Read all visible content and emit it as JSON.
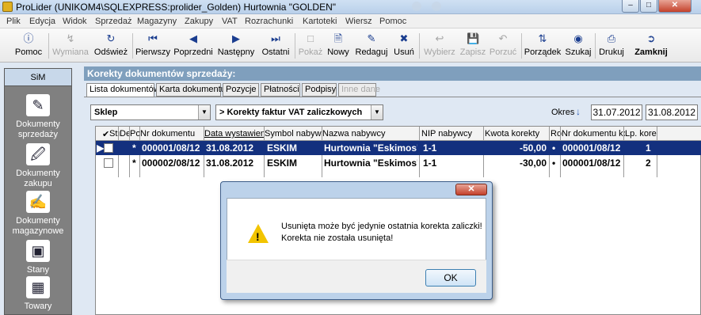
{
  "window": {
    "title": "ProLider  (UNIKOM4\\SQLEXPRESS:prolider_Golden) Hurtownia \"GOLDEN\"",
    "minimize": "–",
    "maximize": "□",
    "close": "✕"
  },
  "menu": [
    "Plik",
    "Edycja",
    "Widok",
    "Sprzedaż",
    "Magazyny",
    "Zakupy",
    "VAT",
    "Rozrachunki",
    "Kartoteki",
    "Wiersz",
    "Pomoc"
  ],
  "toolbar": {
    "pomoc": "Pomoc",
    "wymiana": "Wymiana",
    "odswiez": "Odśwież",
    "pierwszy": "Pierwszy",
    "poprzedni": "Poprzedni",
    "nastepny": "Następny",
    "ostatni": "Ostatni",
    "pokaz": "Pokaż",
    "nowy": "Nowy",
    "redaguj": "Redaguj",
    "usun": "Usuń",
    "wybierz": "Wybierz",
    "zapisz": "Zapisz",
    "porzuc": "Porzuć",
    "porzadek": "Porządek",
    "szukaj": "Szukaj",
    "drukuj": "Drukuj",
    "zamknij": "Zamknij"
  },
  "sidebar": {
    "header": "SiM",
    "items": [
      {
        "line1": "Dokumenty",
        "line2": "sprzedaży",
        "icon": "pen-document-icon"
      },
      {
        "line1": "Dokumenty",
        "line2": "zakupu",
        "icon": "purchase-document-icon"
      },
      {
        "line1": "Dokumenty",
        "line2": "magazynowe",
        "icon": "warehouse-document-icon"
      },
      {
        "line1": "Stany",
        "line2": "",
        "icon": "stock-icon"
      },
      {
        "line1": "Towary",
        "line2": "",
        "icon": "goods-icon"
      }
    ]
  },
  "main": {
    "header": "Korekty dokumentów sprzedaży:",
    "tabs": [
      "Lista dokumentów",
      "Karta dokumentu",
      "Pozycje",
      "Płatności",
      "Podpisy",
      "Inne dane"
    ],
    "store_combo": "Sklep",
    "type_combo": "> Korekty faktur VAT zaliczkowych",
    "okres_label": "Okres",
    "date_from": "31.07.2012",
    "date_to": "31.08.2012"
  },
  "grid": {
    "columns": [
      "✔",
      "Stı",
      "De",
      "Po",
      "Nr dokumentu",
      "Data wystawienia",
      "Symbol nabywcy",
      "Nazwa nabywcy",
      "NIP nabywcy",
      "Kwota korekty",
      "Ro",
      "Nr dokumentu kor",
      "Lp. kore"
    ],
    "rows": [
      {
        "star": "*",
        "nr": "000001/08/12",
        "data": "31.08.2012",
        "symbol": "ESKIM",
        "nazwa": "Hurtownia \"Eskimos\"",
        "nip": "1-1",
        "kwota": "-50,00",
        "ro": "•",
        "nrkor": "000001/08/12",
        "lp": "1"
      },
      {
        "star": "*",
        "nr": "000002/08/12",
        "data": "31.08.2012",
        "symbol": "ESKIM",
        "nazwa": "Hurtownia \"Eskimos\"",
        "nip": "1-1",
        "kwota": "-30,00",
        "ro": "•",
        "nrkor": "000001/08/12",
        "lp": "2"
      }
    ]
  },
  "dialog": {
    "close": "✕",
    "line1": "Usunięta może być jedynie ostatnia korekta zaliczki!",
    "line2": "Korekta nie została usunięta!",
    "ok": "OK"
  }
}
